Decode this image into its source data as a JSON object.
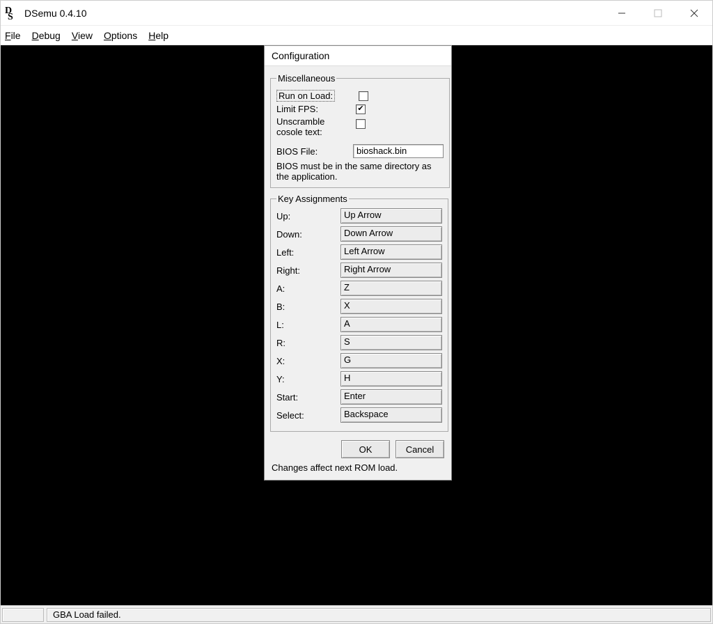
{
  "window": {
    "title": "DSemu 0.4.10"
  },
  "menu": {
    "file": "File",
    "debug": "Debug",
    "view": "View",
    "options": "Options",
    "help": "Help"
  },
  "status": {
    "message": "GBA Load failed."
  },
  "dialog": {
    "title": "Configuration",
    "misc": {
      "legend": "Miscellaneous",
      "run_on_load_label": "Run on Load:",
      "run_on_load_checked": false,
      "limit_fps_label": "Limit FPS:",
      "limit_fps_checked": true,
      "unscramble_label": "Unscramble cosole text:",
      "unscramble_checked": false,
      "bios_label": "BIOS File:",
      "bios_value": "bioshack.bin",
      "bios_note": "BIOS must be in the same directory as the application."
    },
    "keys": {
      "legend": "Key Assignments",
      "rows": [
        {
          "label": "Up:",
          "value": "Up Arrow"
        },
        {
          "label": "Down:",
          "value": "Down Arrow"
        },
        {
          "label": "Left:",
          "value": "Left Arrow"
        },
        {
          "label": "Right:",
          "value": "Right Arrow"
        },
        {
          "label": "A:",
          "value": "Z"
        },
        {
          "label": "B:",
          "value": "X"
        },
        {
          "label": "L:",
          "value": "A"
        },
        {
          "label": "R:",
          "value": "S"
        },
        {
          "label": "X:",
          "value": "G"
        },
        {
          "label": "Y:",
          "value": "H"
        },
        {
          "label": "Start:",
          "value": "Enter"
        },
        {
          "label": "Select:",
          "value": "Backspace"
        }
      ]
    },
    "buttons": {
      "ok": "OK",
      "cancel": "Cancel"
    },
    "footer": "Changes affect next ROM load."
  }
}
